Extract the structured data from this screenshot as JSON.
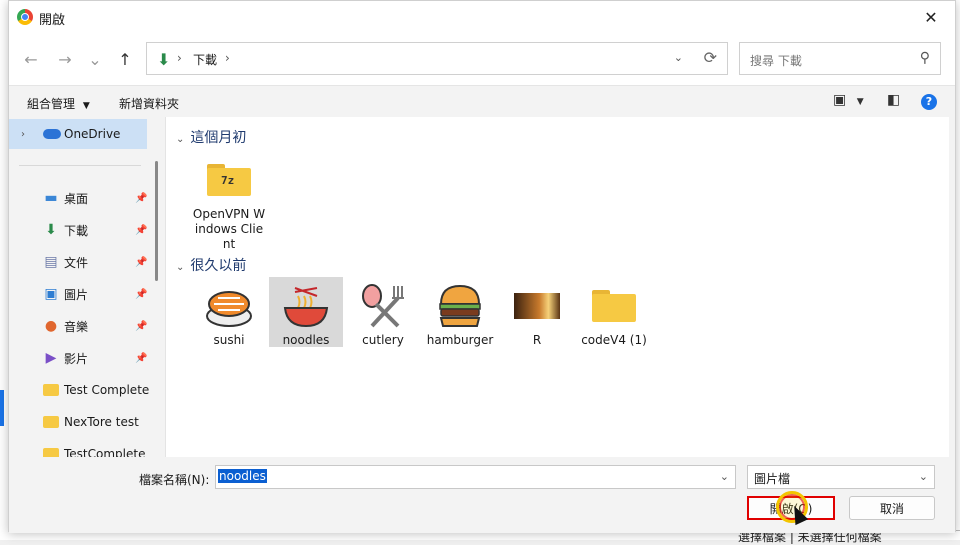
{
  "window": {
    "title": "開啟",
    "close_label": "✕"
  },
  "nav": {
    "back_icon": "←",
    "forward_icon": "→",
    "recent_icon": "⌄",
    "up_icon": "↑",
    "address_path": [
      "下載"
    ],
    "address_separator": "›",
    "refresh_icon": "⟳",
    "search_placeholder": "搜尋 下載",
    "search_icon": "⚲"
  },
  "toolbar": {
    "organize_label": "組合管理",
    "new_folder_label": "新增資料夾",
    "view_icon": "▣",
    "preview_icon": "◧",
    "help_label": "?"
  },
  "sidebar": {
    "onedrive_label": "OneDrive",
    "items": [
      {
        "label": "桌面",
        "icon": "desktop-icon",
        "color": "#3a86d6",
        "pinned": true
      },
      {
        "label": "下載",
        "icon": "download-icon",
        "color": "#2a8a4a",
        "pinned": true
      },
      {
        "label": "文件",
        "icon": "document-icon",
        "color": "#6b7aa8",
        "pinned": true
      },
      {
        "label": "圖片",
        "icon": "picture-icon",
        "color": "#2e7dd2",
        "pinned": true
      },
      {
        "label": "音樂",
        "icon": "music-icon",
        "color": "#e0662e",
        "pinned": true
      },
      {
        "label": "影片",
        "icon": "video-icon",
        "color": "#7a4fc7",
        "pinned": true
      },
      {
        "label": "Test Complete",
        "icon": "folder-icon",
        "color": "#f6c943",
        "pinned": false
      },
      {
        "label": "NexTore test",
        "icon": "folder-icon",
        "color": "#f6c943",
        "pinned": false
      },
      {
        "label": "TestComplete",
        "icon": "folder-icon",
        "color": "#f6c943",
        "pinned": false
      }
    ]
  },
  "groups": [
    {
      "label": "這個月初",
      "files": [
        {
          "name": "OpenVPN Windows Client",
          "icon": "folder-7z-icon",
          "badge": "7z"
        }
      ]
    },
    {
      "label": "很久以前",
      "files": [
        {
          "name": "sushi",
          "icon": "sushi-icon"
        },
        {
          "name": "noodles",
          "icon": "noodles-icon",
          "selected": true
        },
        {
          "name": "cutlery",
          "icon": "cutlery-icon"
        },
        {
          "name": "hamburger",
          "icon": "hamburger-icon"
        },
        {
          "name": "R",
          "icon": "photo-icon"
        },
        {
          "name": "codeV4 (1)",
          "icon": "folder-icon"
        }
      ]
    }
  ],
  "footer": {
    "filename_label": "檔案名稱(N):",
    "filename_value": "noodles",
    "filetype_value": "圖片檔",
    "open_label": "開啟(O)",
    "cancel_label": "取消"
  },
  "background": {
    "text": "選擇檔案 | 未選擇任何檔案"
  }
}
